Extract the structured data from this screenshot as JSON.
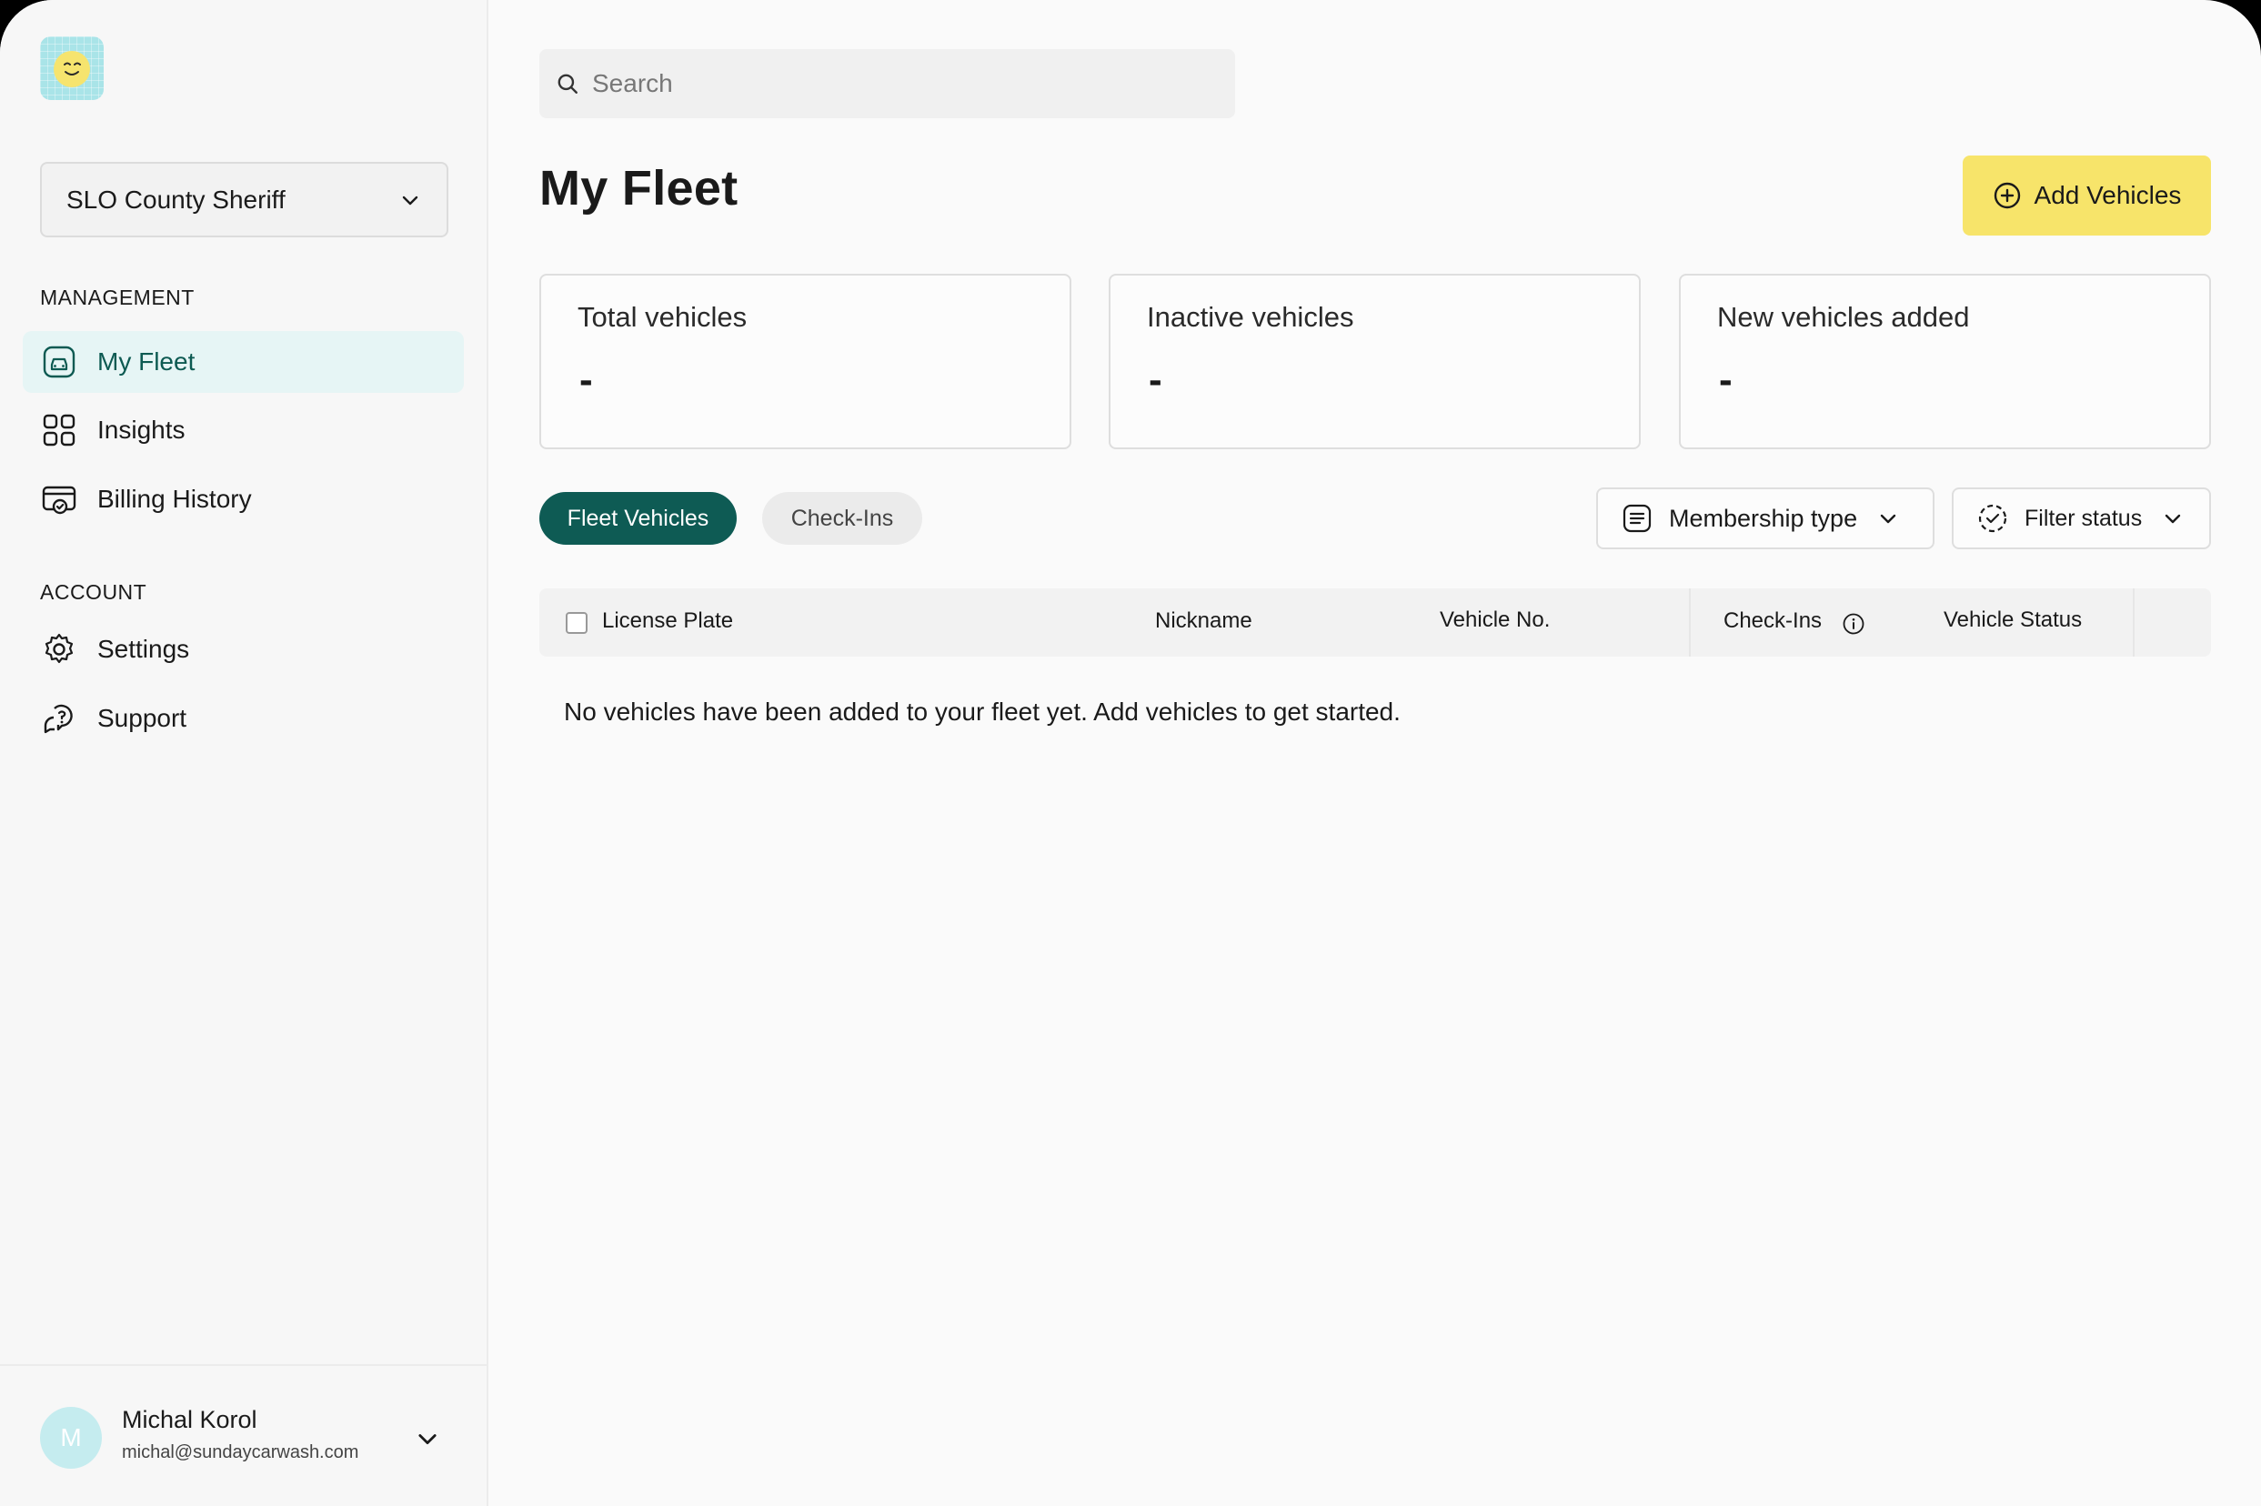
{
  "sidebar": {
    "org_selector": {
      "value": "SLO County Sheriff"
    },
    "sections": [
      {
        "label": "MANAGEMENT",
        "items": [
          {
            "label": "My Fleet",
            "icon": "car-icon",
            "active": true
          },
          {
            "label": "Insights",
            "icon": "grid-icon",
            "active": false
          },
          {
            "label": "Billing History",
            "icon": "billing-icon",
            "active": false
          }
        ]
      },
      {
        "label": "ACCOUNT",
        "items": [
          {
            "label": "Settings",
            "icon": "gear-icon",
            "active": false
          },
          {
            "label": "Support",
            "icon": "support-icon",
            "active": false
          }
        ]
      }
    ],
    "user": {
      "initial": "M",
      "name": "Michal Korol",
      "email": "michal@sundaycarwash.com"
    }
  },
  "search": {
    "placeholder": "Search"
  },
  "header": {
    "title": "My Fleet",
    "add_button_label": "Add Vehicles"
  },
  "stats": [
    {
      "label": "Total vehicles",
      "value": "-"
    },
    {
      "label": "Inactive vehicles",
      "value": "-"
    },
    {
      "label": "New vehicles added",
      "value": "-"
    }
  ],
  "tabs": [
    {
      "label": "Fleet Vehicles",
      "active": true
    },
    {
      "label": "Check-Ins",
      "active": false
    }
  ],
  "filters": {
    "membership": "Membership type",
    "status": "Filter status"
  },
  "table": {
    "columns": [
      "License Plate",
      "Nickname",
      "Vehicle No.",
      "Check-Ins",
      "Vehicle Status"
    ],
    "empty_message": "No vehicles have been added to your fleet yet. Add vehicles to get started."
  },
  "colors": {
    "accent": "#0e5b54",
    "add_button": "#f7e46a",
    "active_nav_bg": "#e6f5f5",
    "logo_bg": "#a9e4e8"
  }
}
